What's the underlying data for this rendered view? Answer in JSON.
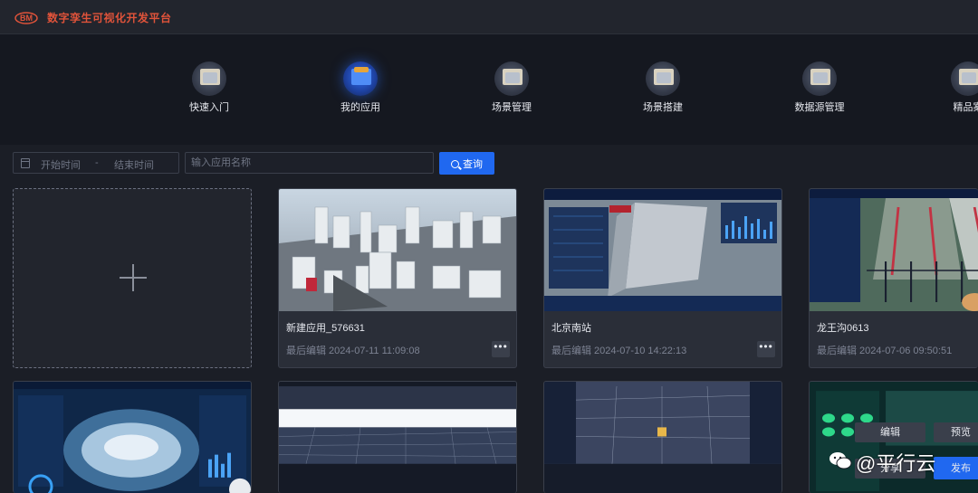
{
  "header": {
    "logo_text": "BM",
    "app_title": "数字孪生可视化开发平台"
  },
  "nav": [
    {
      "label": "快速入门",
      "icon": "quick-start-icon",
      "active": false
    },
    {
      "label": "我的应用",
      "icon": "my-apps-icon",
      "active": true
    },
    {
      "label": "场景管理",
      "icon": "scene-manage-icon",
      "active": false
    },
    {
      "label": "场景搭建",
      "icon": "scene-build-icon",
      "active": false
    },
    {
      "label": "数据源管理",
      "icon": "datasource-icon",
      "active": false
    },
    {
      "label": "精品案",
      "icon": "showcase-icon",
      "active": false
    }
  ],
  "filter": {
    "start_placeholder": "开始时间",
    "separator": "-",
    "end_placeholder": "结束时间",
    "search_placeholder": "输入应用名称",
    "query_label": "查询"
  },
  "cards": [
    {
      "title": "新建应用_576631",
      "edited": "最后编辑 2024-07-11 11:09:08",
      "more": "•••"
    },
    {
      "title": "北京南站",
      "edited": "最后编辑 2024-07-10 14:22:13",
      "more": "•••"
    },
    {
      "title": "龙王沟0613",
      "edited": "最后编辑 2024-07-06 09:50:51",
      "more": "•••"
    }
  ],
  "overlay": {
    "edit": "编辑",
    "preview": "预览",
    "share": "分享",
    "publish": "发布"
  },
  "watermark": "@平行云",
  "colors": {
    "accent": "#2068f0",
    "brand": "#e0533a",
    "background": "#1b1e26"
  }
}
